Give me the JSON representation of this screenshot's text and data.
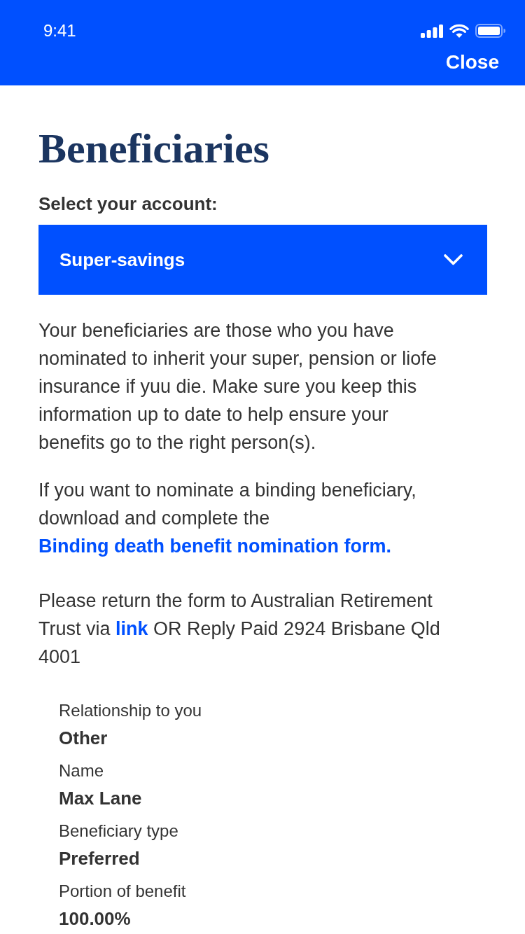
{
  "status_bar": {
    "time": "9:41"
  },
  "header": {
    "close_button": "Close"
  },
  "title": "Beneficiaries",
  "account_select": {
    "label": "Select your account:",
    "value": "Super-savings"
  },
  "paragraphs": [
    {
      "segments": [
        {
          "kind": "text",
          "text": "Your beneficiaries are those who you have nominated to inherit your super, pension or liofe insurance if yuu die. Make sure you keep this information up to date to help ensure your benefits go to the right person(s)."
        }
      ]
    },
    {
      "segments": [
        {
          "kind": "text",
          "text": "If you want to nominate a binding beneficiary, download and complete the "
        },
        {
          "kind": "link",
          "text": "Binding death benefit nomination form."
        }
      ]
    },
    {
      "segments": [
        {
          "kind": "text",
          "text": "Please return the form to Australian Retirement Trust via "
        },
        {
          "kind": "link",
          "text": "link"
        },
        {
          "kind": "text",
          "text": " OR Reply Paid 2924 Brisbane Qld 4001"
        }
      ]
    }
  ],
  "details": [
    {
      "label": "Relationship to you",
      "value": "Other"
    },
    {
      "label": "Name",
      "value": "Max Lane"
    },
    {
      "label": "Beneficiary type",
      "value": "Preferred"
    },
    {
      "label": "Portion of benefit",
      "value": "100.00%"
    }
  ]
}
